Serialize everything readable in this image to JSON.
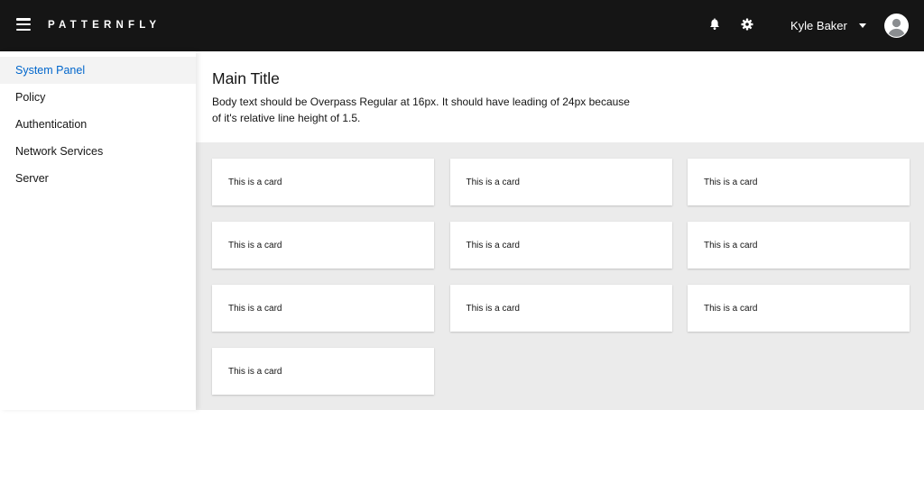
{
  "header": {
    "brand": "PATTERNFLY",
    "user_name": "Kyle Baker",
    "icons": [
      "menu-icon",
      "bell-icon",
      "gear-icon",
      "chevron-down-icon",
      "avatar-icon"
    ]
  },
  "sidebar": {
    "items": [
      {
        "label": "System Panel",
        "active": true
      },
      {
        "label": "Policy"
      },
      {
        "label": "Authentication"
      },
      {
        "label": "Network Services"
      },
      {
        "label": "Server"
      }
    ]
  },
  "main": {
    "title": "Main Title",
    "body": "Body text should be Overpass Regular at 16px. It should have leading of 24px because of it's relative line height of 1.5."
  },
  "cards": [
    "This is a card",
    "This is a card",
    "This is a card",
    "This is a card",
    "This is a card",
    "This is a card",
    "This is a card",
    "This is a card",
    "This is a card",
    "This is a card"
  ],
  "colors": {
    "header_bg": "#151515",
    "accent": "#0066cc",
    "gallery_bg": "#ebebeb"
  }
}
